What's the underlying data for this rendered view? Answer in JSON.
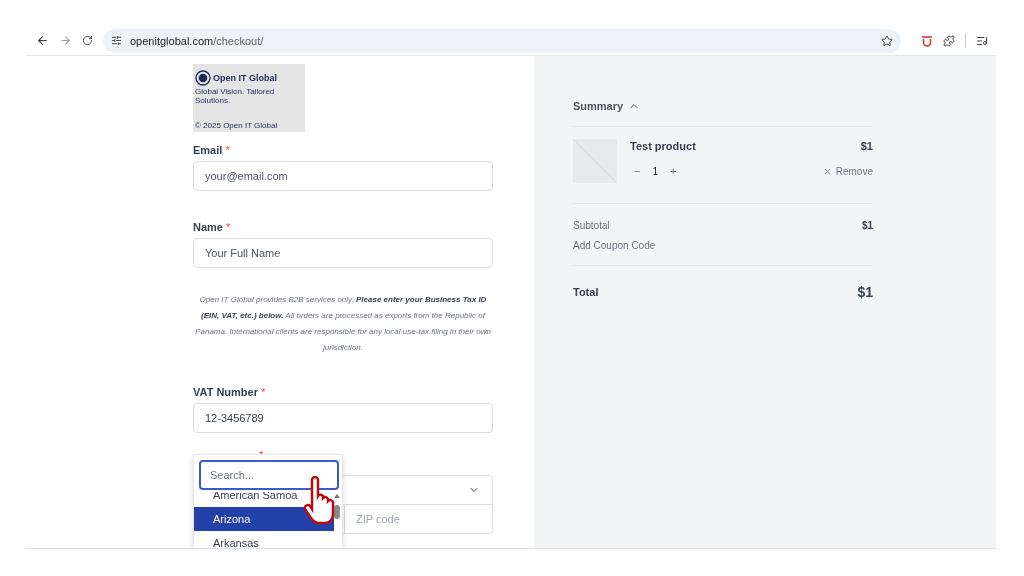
{
  "browser": {
    "url_host": "openitglobal.com",
    "url_path": "/checkout/"
  },
  "logo": {
    "name": "Open IT Global",
    "tagline": "Global Vision. Tailored Solutions.",
    "copyright": "© 2025 Open IT Global"
  },
  "fields": [
    {
      "label": "Email",
      "required_mark": "*",
      "placeholder": "your@email.com"
    },
    {
      "label": "Name",
      "required_mark": "*",
      "placeholder": "Your Full Name"
    }
  ],
  "notice": "*Open IT Global provides B2B services only.* **Please enter your Business Tax ID (EIN, VAT, etc.) below.** *All orders are processed as exports from the Republic of Panama. International clients are responsible for any local use-tax filing in their own jurisdiction.*",
  "vat": {
    "label": "VAT Number",
    "required_mark": "*",
    "value": "12-3456789"
  },
  "address": {
    "required_mark": "*",
    "zip_placeholder": "ZIP code"
  },
  "dropdown": {
    "search_placeholder": "Search...",
    "options": [
      {
        "label": "American Samoa",
        "selected": false
      },
      {
        "label": "Arizona",
        "selected": true
      },
      {
        "label": "Arkansas",
        "selected": false
      }
    ]
  },
  "summary": {
    "title": "Summary",
    "expanded": true,
    "items": [
      {
        "name": "Test product",
        "price": "$1",
        "decrement": "−",
        "quantity": "1",
        "increment": "+",
        "remove_label": "Remove"
      }
    ],
    "subtotal_label": "Subtotal",
    "subtotal": "$1",
    "coupon_label": "Add Coupon Code",
    "total_label": "Total",
    "total": "$1"
  }
}
